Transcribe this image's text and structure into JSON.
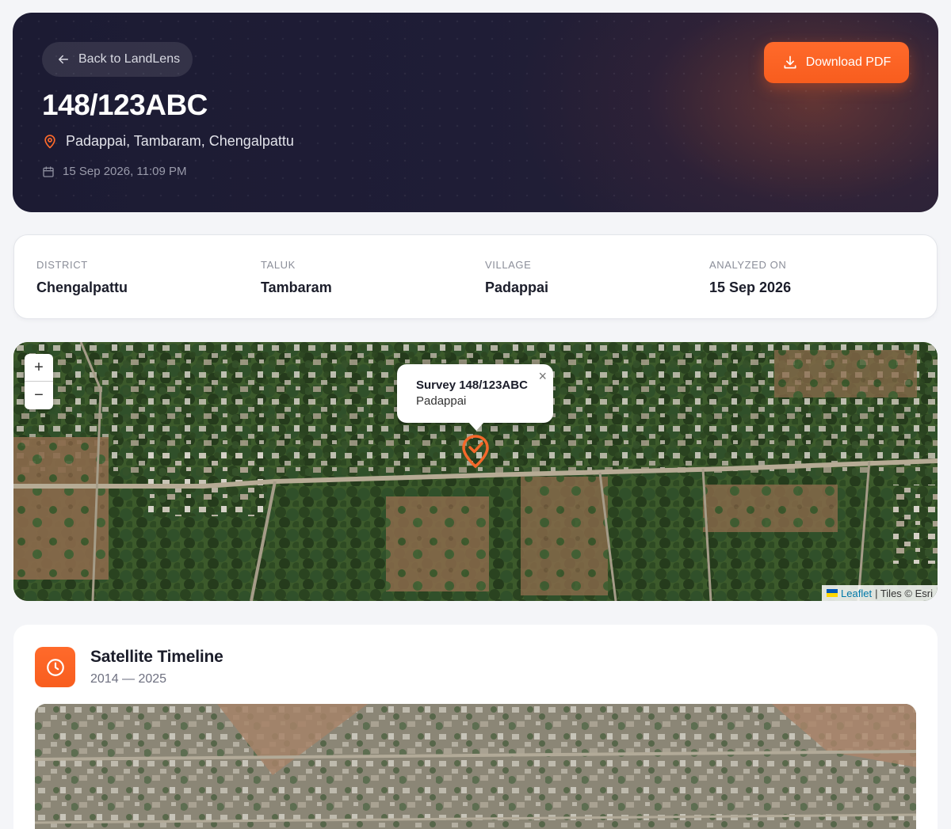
{
  "header": {
    "back_label": "Back to LandLens",
    "download_label": "Download PDF",
    "survey_number": "148/123ABC",
    "location": "Padappai, Tambaram, Chengalpattu",
    "datetime": "15 Sep 2026, 11:09 PM"
  },
  "info": {
    "district": {
      "label": "DISTRICT",
      "value": "Chengalpattu"
    },
    "taluk": {
      "label": "TALUK",
      "value": "Tambaram"
    },
    "village": {
      "label": "VILLAGE",
      "value": "Padappai"
    },
    "analyzed": {
      "label": "ANALYZED ON",
      "value": "15 Sep 2026"
    }
  },
  "map": {
    "zoom_in": "+",
    "zoom_out": "−",
    "popup_title": "Survey 148/123ABC",
    "popup_subtitle": "Padappai",
    "popup_close": "×",
    "attribution_link": "Leaflet",
    "attribution_text": "| Tiles © Esri"
  },
  "timeline": {
    "title": "Satellite Timeline",
    "range": "2014 — 2025"
  },
  "colors": {
    "accent": "#f85d1e",
    "hero_bg": "#1c1b33"
  },
  "icons": {
    "back": "arrow-left-icon",
    "download": "download-icon",
    "location": "map-pin-icon",
    "date": "calendar-icon",
    "marker": "map-marker-icon",
    "timeline": "clock-icon"
  }
}
